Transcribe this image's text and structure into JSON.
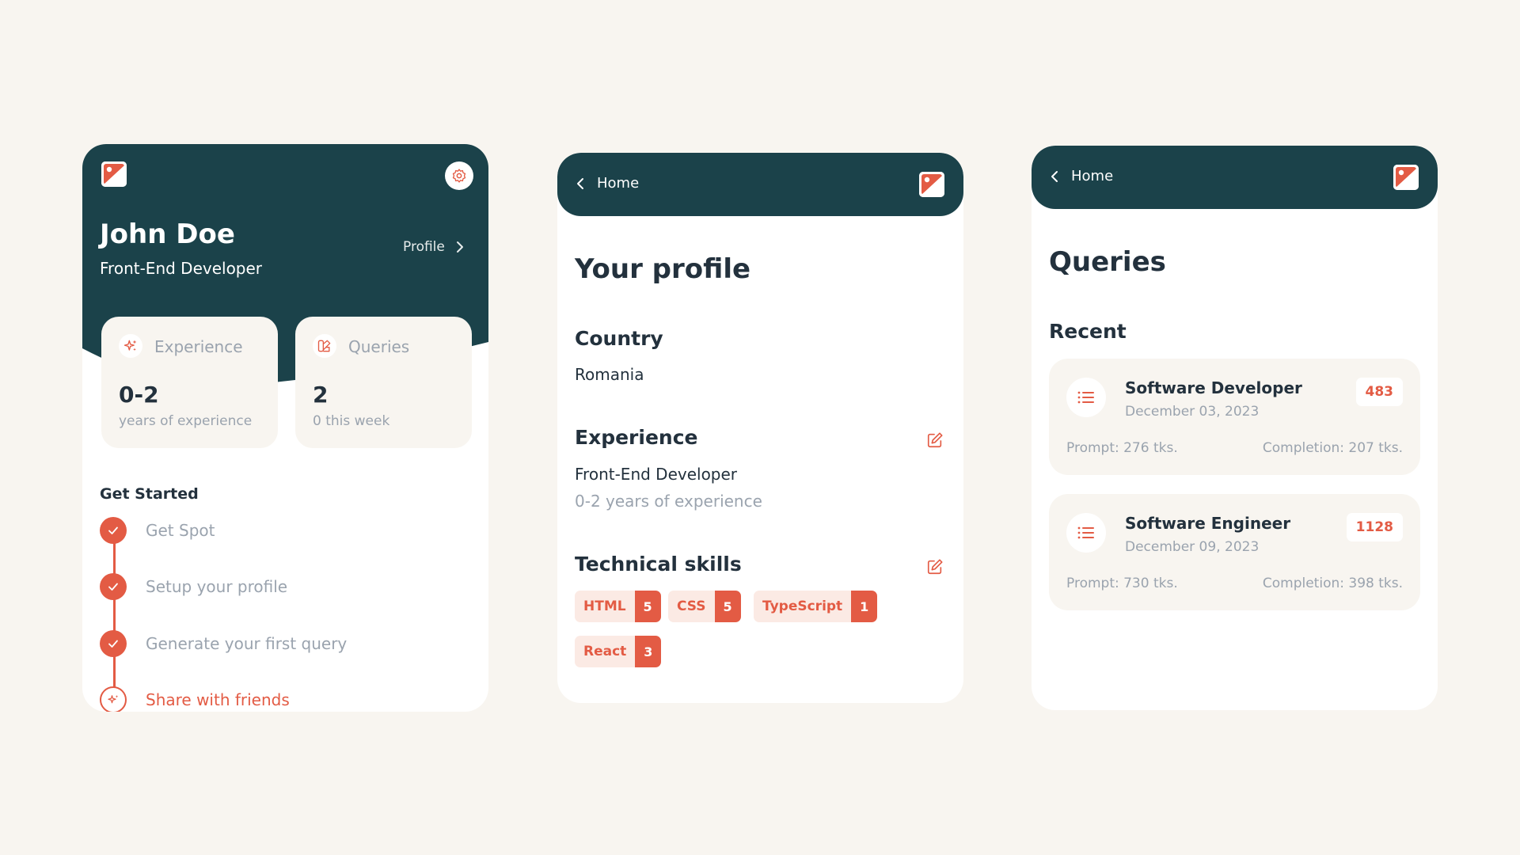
{
  "colors": {
    "page_bg": "#f8f5f0",
    "brand_dark": "#1b424a",
    "accent": "#e35b44",
    "muted_text": "#9aa3ae",
    "heading_text": "#23313d"
  },
  "card1": {
    "logo_icon": "image-logo-icon",
    "settings_icon": "gear-icon",
    "name": "John Doe",
    "role": "Front-End Developer",
    "profile_link": "Profile",
    "stats": [
      {
        "icon": "sparkle-icon",
        "label": "Experience",
        "value": "0-2",
        "sub": "years of experience"
      },
      {
        "icon": "shapes-icon",
        "label": "Queries",
        "value": "2",
        "sub": "0 this week"
      }
    ],
    "get_started_title": "Get Started",
    "steps": [
      {
        "label": "Get Spot",
        "status": "done"
      },
      {
        "label": "Setup your profile",
        "status": "done"
      },
      {
        "label": "Generate your first query",
        "status": "done"
      },
      {
        "label": "Share with friends",
        "status": "active"
      }
    ]
  },
  "card2": {
    "nav_back": "Home",
    "title": "Your profile",
    "country_heading": "Country",
    "country_value": "Romania",
    "experience_heading": "Experience",
    "experience_role": "Front-End Developer",
    "experience_years": "0-2 years of experience",
    "skills_heading": "Technical skills",
    "skills": [
      {
        "name": "HTML",
        "count": "5"
      },
      {
        "name": "CSS",
        "count": "5"
      },
      {
        "name": "TypeScript",
        "count": "1"
      },
      {
        "name": "React",
        "count": "3"
      }
    ]
  },
  "card3": {
    "nav_back": "Home",
    "title": "Queries",
    "recent_heading": "Recent",
    "queries": [
      {
        "title": "Software Developer",
        "date": "December 03, 2023",
        "badge": "483",
        "prompt": "Prompt: 276 tks.",
        "completion": "Completion: 207 tks."
      },
      {
        "title": "Software Engineer",
        "date": "December 09, 2023",
        "badge": "1128",
        "prompt": "Prompt: 730 tks.",
        "completion": "Completion: 398 tks."
      }
    ]
  }
}
